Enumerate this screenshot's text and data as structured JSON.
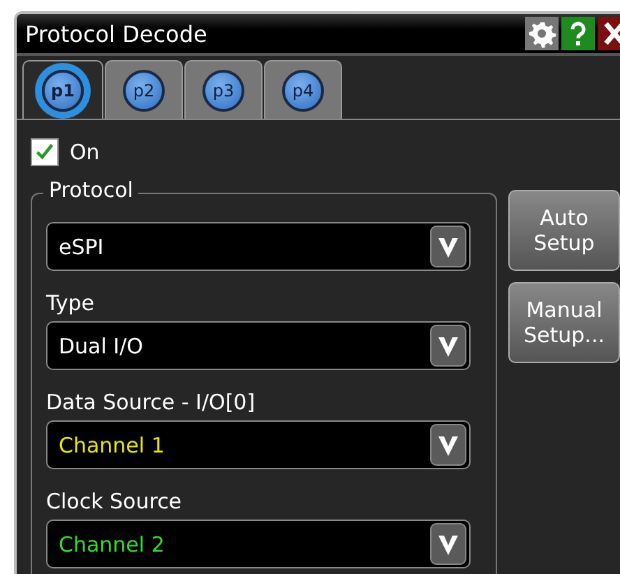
{
  "window": {
    "title": "Protocol Decode"
  },
  "tabs": [
    {
      "label": "p1",
      "selected": true
    },
    {
      "label": "p2",
      "selected": false
    },
    {
      "label": "p3",
      "selected": false
    },
    {
      "label": "p4",
      "selected": false
    }
  ],
  "on": {
    "label": "On",
    "checked": true
  },
  "group": {
    "title": "Protocol",
    "fields": [
      {
        "value": "eSPI",
        "color": "#ffffff"
      },
      {
        "label": "Type",
        "value": "Dual I/O",
        "color": "#ffffff"
      },
      {
        "label": "Data Source - I/O[0]",
        "value": "Channel 1",
        "color": "#e6e600"
      },
      {
        "label": "Clock Source",
        "value": "Channel 2",
        "color": "#33dd22"
      }
    ]
  },
  "buttons": [
    {
      "lines": [
        "Auto",
        "Setup"
      ]
    },
    {
      "lines": [
        "Manual",
        "Setup..."
      ]
    }
  ]
}
